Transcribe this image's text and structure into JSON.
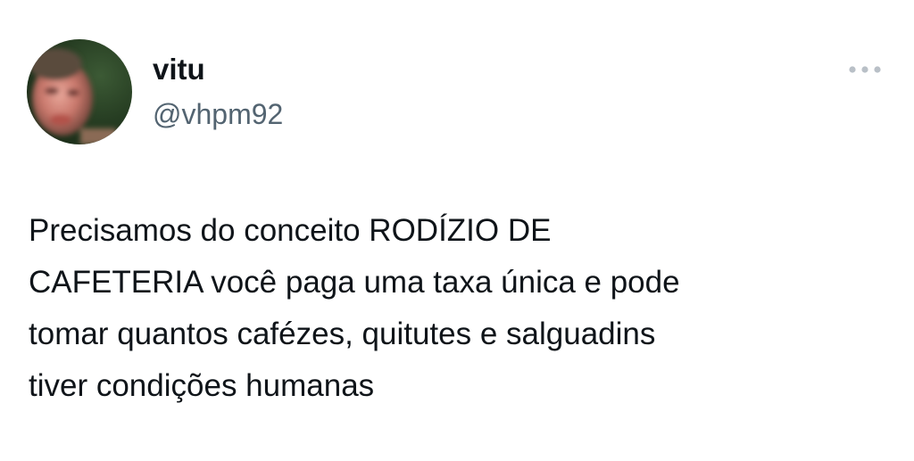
{
  "tweet": {
    "author": {
      "display_name": "vitu",
      "handle": "@vhpm92",
      "avatar_icon": "profile-photo"
    },
    "more_icon": "more-options-icon",
    "text": "Precisamos do conceito RODÍZIO DE\nCAFETERIA você paga uma taxa única e pode\ntomar quantos cafézes, quitutes e salguadins\ntiver condições humanas"
  },
  "colors": {
    "background": "#ffffff",
    "text_primary": "#0f1419",
    "text_secondary": "#536471",
    "icon_muted": "#b9c0c7"
  }
}
